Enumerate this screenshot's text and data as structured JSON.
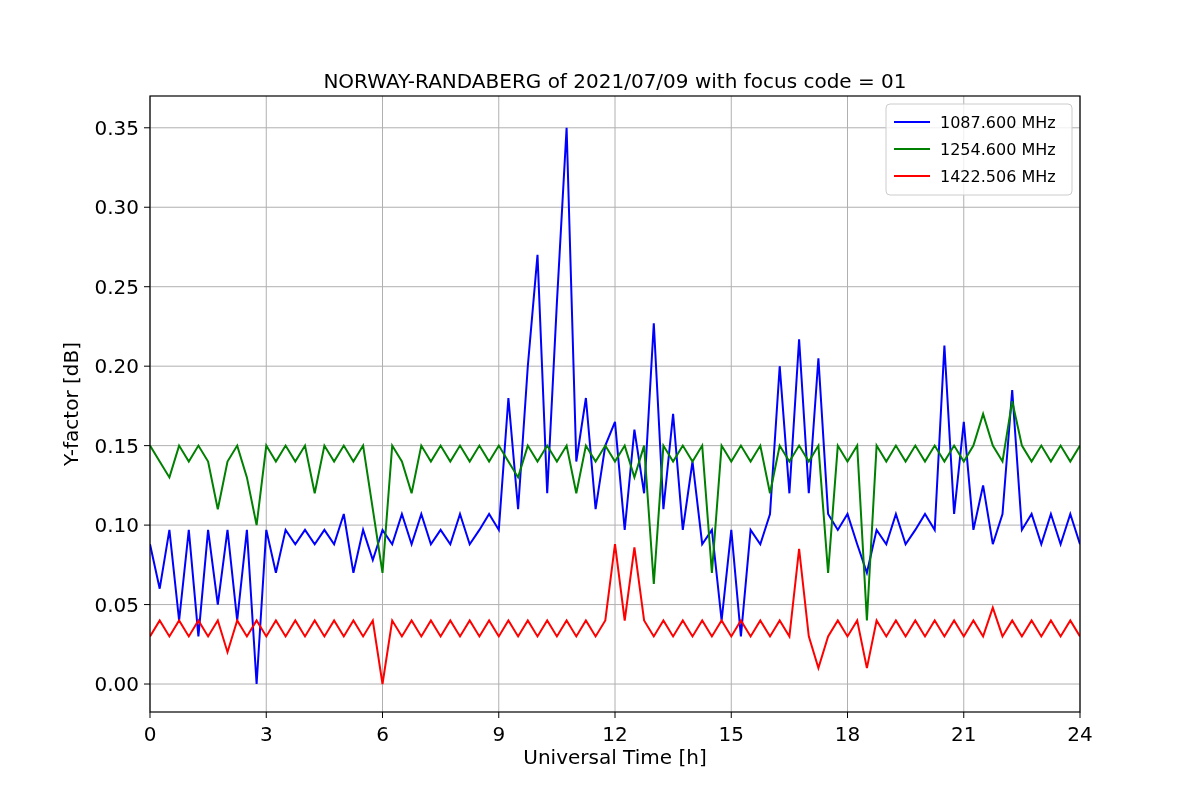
{
  "chart_data": {
    "type": "line",
    "title": "NORWAY-RANDABERG of 2021/07/09 with focus code = 01",
    "xlabel": "Universal Time [h]",
    "ylabel": "Y-factor [dB]",
    "x": [
      0,
      0.25,
      0.5,
      0.75,
      1,
      1.25,
      1.5,
      1.75,
      2,
      2.25,
      2.5,
      2.75,
      3,
      3.25,
      3.5,
      3.75,
      4,
      4.25,
      4.5,
      4.75,
      5,
      5.25,
      5.5,
      5.75,
      6,
      6.25,
      6.5,
      6.75,
      7,
      7.25,
      7.5,
      7.75,
      8,
      8.25,
      8.5,
      8.75,
      9,
      9.25,
      9.5,
      9.75,
      10,
      10.25,
      10.5,
      10.75,
      11,
      11.25,
      11.5,
      11.75,
      12,
      12.25,
      12.5,
      12.75,
      13,
      13.25,
      13.5,
      13.75,
      14,
      14.25,
      14.5,
      14.75,
      15,
      15.25,
      15.5,
      15.75,
      16,
      16.25,
      16.5,
      16.75,
      17,
      17.25,
      17.5,
      17.75,
      18,
      18.25,
      18.5,
      18.75,
      19,
      19.25,
      19.5,
      19.75,
      20,
      20.25,
      20.5,
      20.75,
      21,
      21.25,
      21.5,
      21.75,
      22,
      22.25,
      22.5,
      22.75,
      23,
      23.25,
      23.5,
      23.75,
      24
    ],
    "series": [
      {
        "name": "1087.600 MHz",
        "color": "#0000ff",
        "values": [
          0.088,
          0.06,
          0.097,
          0.04,
          0.097,
          0.03,
          0.097,
          0.05,
          0.097,
          0.04,
          0.097,
          0.0,
          0.097,
          0.07,
          0.097,
          0.088,
          0.097,
          0.088,
          0.097,
          0.088,
          0.107,
          0.07,
          0.097,
          0.078,
          0.097,
          0.088,
          0.107,
          0.088,
          0.107,
          0.088,
          0.097,
          0.088,
          0.107,
          0.088,
          0.097,
          0.107,
          0.097,
          0.18,
          0.11,
          0.2,
          0.27,
          0.12,
          0.24,
          0.35,
          0.14,
          0.18,
          0.11,
          0.15,
          0.165,
          0.097,
          0.16,
          0.12,
          0.227,
          0.11,
          0.17,
          0.097,
          0.14,
          0.088,
          0.097,
          0.04,
          0.097,
          0.03,
          0.097,
          0.088,
          0.107,
          0.2,
          0.12,
          0.217,
          0.12,
          0.205,
          0.107,
          0.097,
          0.107,
          0.088,
          0.07,
          0.097,
          0.088,
          0.107,
          0.088,
          0.097,
          0.107,
          0.097,
          0.213,
          0.107,
          0.165,
          0.097,
          0.125,
          0.088,
          0.107,
          0.185,
          0.097,
          0.107,
          0.088,
          0.107,
          0.088,
          0.107,
          0.088
        ]
      },
      {
        "name": "1254.600 MHz",
        "color": "#008000",
        "values": [
          0.15,
          0.14,
          0.13,
          0.15,
          0.14,
          0.15,
          0.14,
          0.11,
          0.14,
          0.15,
          0.13,
          0.1,
          0.15,
          0.14,
          0.15,
          0.14,
          0.15,
          0.12,
          0.15,
          0.14,
          0.15,
          0.14,
          0.15,
          0.11,
          0.07,
          0.15,
          0.14,
          0.12,
          0.15,
          0.14,
          0.15,
          0.14,
          0.15,
          0.14,
          0.15,
          0.14,
          0.15,
          0.14,
          0.13,
          0.15,
          0.14,
          0.15,
          0.14,
          0.15,
          0.12,
          0.15,
          0.14,
          0.15,
          0.14,
          0.15,
          0.13,
          0.15,
          0.063,
          0.15,
          0.14,
          0.15,
          0.14,
          0.15,
          0.07,
          0.15,
          0.14,
          0.15,
          0.14,
          0.15,
          0.12,
          0.15,
          0.14,
          0.15,
          0.14,
          0.15,
          0.07,
          0.15,
          0.14,
          0.15,
          0.04,
          0.15,
          0.14,
          0.15,
          0.14,
          0.15,
          0.14,
          0.15,
          0.14,
          0.15,
          0.14,
          0.15,
          0.17,
          0.15,
          0.14,
          0.178,
          0.15,
          0.14,
          0.15,
          0.14,
          0.15,
          0.14,
          0.15
        ]
      },
      {
        "name": "1422.506 MHz",
        "color": "#ff0000",
        "values": [
          0.03,
          0.04,
          0.03,
          0.04,
          0.03,
          0.04,
          0.03,
          0.04,
          0.02,
          0.04,
          0.03,
          0.04,
          0.03,
          0.04,
          0.03,
          0.04,
          0.03,
          0.04,
          0.03,
          0.04,
          0.03,
          0.04,
          0.03,
          0.04,
          0.0,
          0.04,
          0.03,
          0.04,
          0.03,
          0.04,
          0.03,
          0.04,
          0.03,
          0.04,
          0.03,
          0.04,
          0.03,
          0.04,
          0.03,
          0.04,
          0.03,
          0.04,
          0.03,
          0.04,
          0.03,
          0.04,
          0.03,
          0.04,
          0.088,
          0.04,
          0.086,
          0.04,
          0.03,
          0.04,
          0.03,
          0.04,
          0.03,
          0.04,
          0.03,
          0.04,
          0.03,
          0.04,
          0.03,
          0.04,
          0.03,
          0.04,
          0.03,
          0.085,
          0.03,
          0.01,
          0.03,
          0.04,
          0.03,
          0.04,
          0.01,
          0.04,
          0.03,
          0.04,
          0.03,
          0.04,
          0.03,
          0.04,
          0.03,
          0.04,
          0.03,
          0.04,
          0.03,
          0.048,
          0.03,
          0.04,
          0.03,
          0.04,
          0.03,
          0.04,
          0.03,
          0.04,
          0.03
        ]
      }
    ],
    "grid": true,
    "legend": "upper right",
    "xlim": [
      0,
      24
    ],
    "ylim": [
      -0.0176,
      0.37
    ],
    "xticks": [
      0,
      3,
      6,
      9,
      12,
      15,
      18,
      21,
      24
    ],
    "yticks": [
      {
        "value": 0,
        "label": "0.00"
      },
      {
        "value": 0.05,
        "label": "0.05"
      },
      {
        "value": 0.1,
        "label": "0.10"
      },
      {
        "value": 0.15,
        "label": "0.15"
      },
      {
        "value": 0.2,
        "label": "0.20"
      },
      {
        "value": 0.25,
        "label": "0.25"
      },
      {
        "value": 0.3,
        "label": "0.30"
      },
      {
        "value": 0.35,
        "label": "0.35"
      }
    ]
  }
}
